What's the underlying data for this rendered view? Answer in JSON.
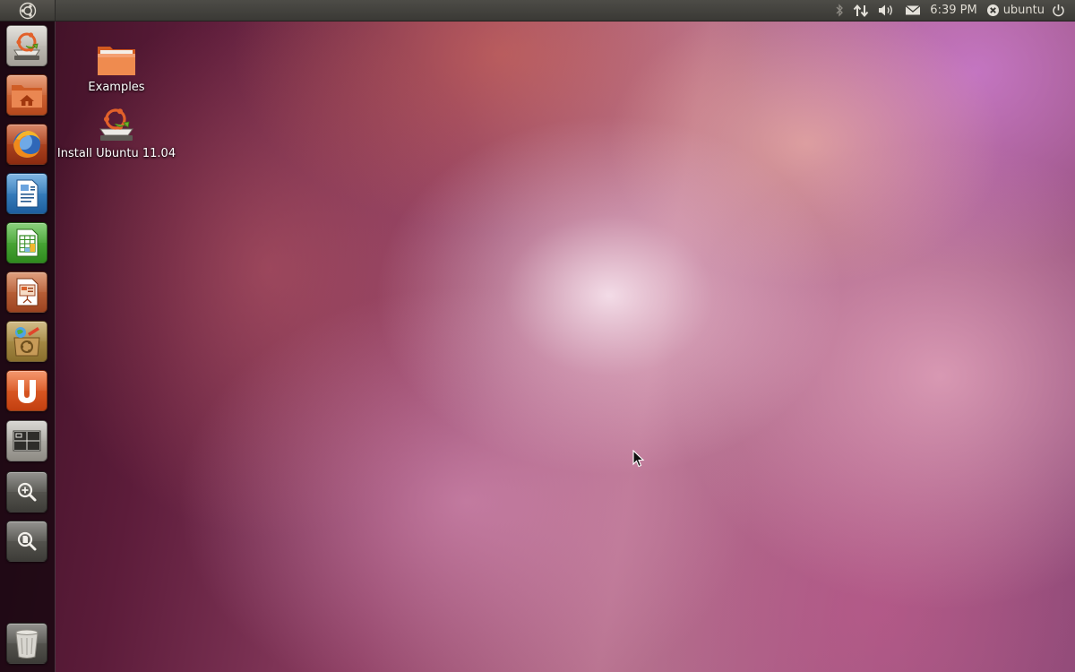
{
  "top_panel": {
    "icons": [
      "ubuntu-logo-icon",
      "bluetooth-icon",
      "network-icon",
      "volume-icon",
      "mail-icon",
      "session-user-icon",
      "power-icon"
    ],
    "clock": "6:39 PM",
    "user": "ubuntu"
  },
  "launcher": {
    "items": [
      {
        "name": "install-ubuntu-launcher",
        "icon": "installer-icon"
      },
      {
        "name": "home-folder-launcher",
        "icon": "home-folder-icon"
      },
      {
        "name": "firefox-launcher",
        "icon": "firefox-icon"
      },
      {
        "name": "writer-launcher",
        "icon": "writer-icon"
      },
      {
        "name": "calc-launcher",
        "icon": "calc-icon"
      },
      {
        "name": "impress-launcher",
        "icon": "impress-icon"
      },
      {
        "name": "software-center-launcher",
        "icon": "software-center-icon"
      },
      {
        "name": "ubuntu-one-launcher",
        "icon": "ubuntu-one-icon"
      },
      {
        "name": "workspaces-launcher",
        "icon": "workspaces-icon"
      },
      {
        "name": "applications-lens-launcher",
        "icon": "applications-lens-icon"
      },
      {
        "name": "files-lens-launcher",
        "icon": "files-lens-icon"
      },
      {
        "name": "trash-launcher",
        "icon": "trash-icon"
      }
    ]
  },
  "desktop": {
    "icons": [
      {
        "label": "Examples",
        "icon": "folder-icon"
      },
      {
        "label": "Install Ubuntu 11.04",
        "icon": "installer-icon"
      }
    ]
  },
  "colors": {
    "panel": "#3c3b37",
    "panel_text": "#dfdbd2",
    "ubuntu_orange": "#dd4814",
    "launcher_bg": "#1a0610"
  }
}
